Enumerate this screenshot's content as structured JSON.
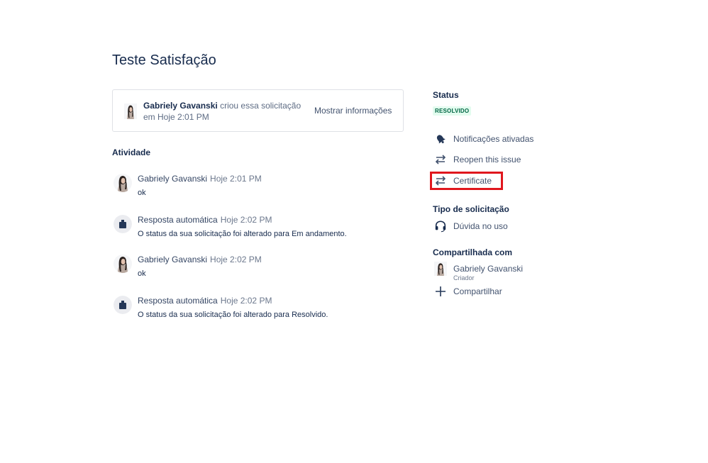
{
  "request": {
    "title": "Teste Satisfação",
    "creator_name": "Gabriely Gavanski",
    "created_text": " criou essa solicitação em Hoje 2:01 PM",
    "toggle_details": "Mostrar informações"
  },
  "activity": {
    "heading": "Atividade",
    "items": [
      {
        "author": "Gabriely Gavanski",
        "time": "Hoje 2:01 PM",
        "body": "ok",
        "avatar": "user-avatar"
      },
      {
        "author": "Resposta automática",
        "time": "Hoje 2:02 PM",
        "body": "O status da sua solicitação foi alterado para Em andamento.",
        "avatar": "bot-avatar"
      },
      {
        "author": "Gabriely Gavanski",
        "time": "Hoje 2:02 PM",
        "body": "ok",
        "avatar": "user-avatar"
      },
      {
        "author": "Resposta automática",
        "time": "Hoje 2:02 PM",
        "body": "O status da sua solicitação foi alterado para Resolvido.",
        "avatar": "bot-avatar"
      }
    ]
  },
  "sidebar": {
    "status_label": "Status",
    "status_value": "RESOLVIDO",
    "actions": [
      {
        "label": "Notificações ativadas",
        "icon": "bell-icon"
      },
      {
        "label": "Reopen this issue",
        "icon": "transition-arrows-icon"
      },
      {
        "label": "Certificate",
        "icon": "transition-arrows-icon"
      }
    ],
    "request_type_label": "Tipo de solicitação",
    "request_type_value": "Dúvida no uso",
    "request_type_icon": "headset-icon",
    "shared_label": "Compartilhada com",
    "shared_user": "Gabriely Gavanski",
    "shared_user_role": "Criador",
    "share_action": "Compartilhar"
  },
  "colors": {
    "text_primary": "#172b4d",
    "text_secondary": "#42526e",
    "lozenge_bg": "#e3fcef",
    "lozenge_text": "#006644",
    "highlight": "#e0171e"
  }
}
